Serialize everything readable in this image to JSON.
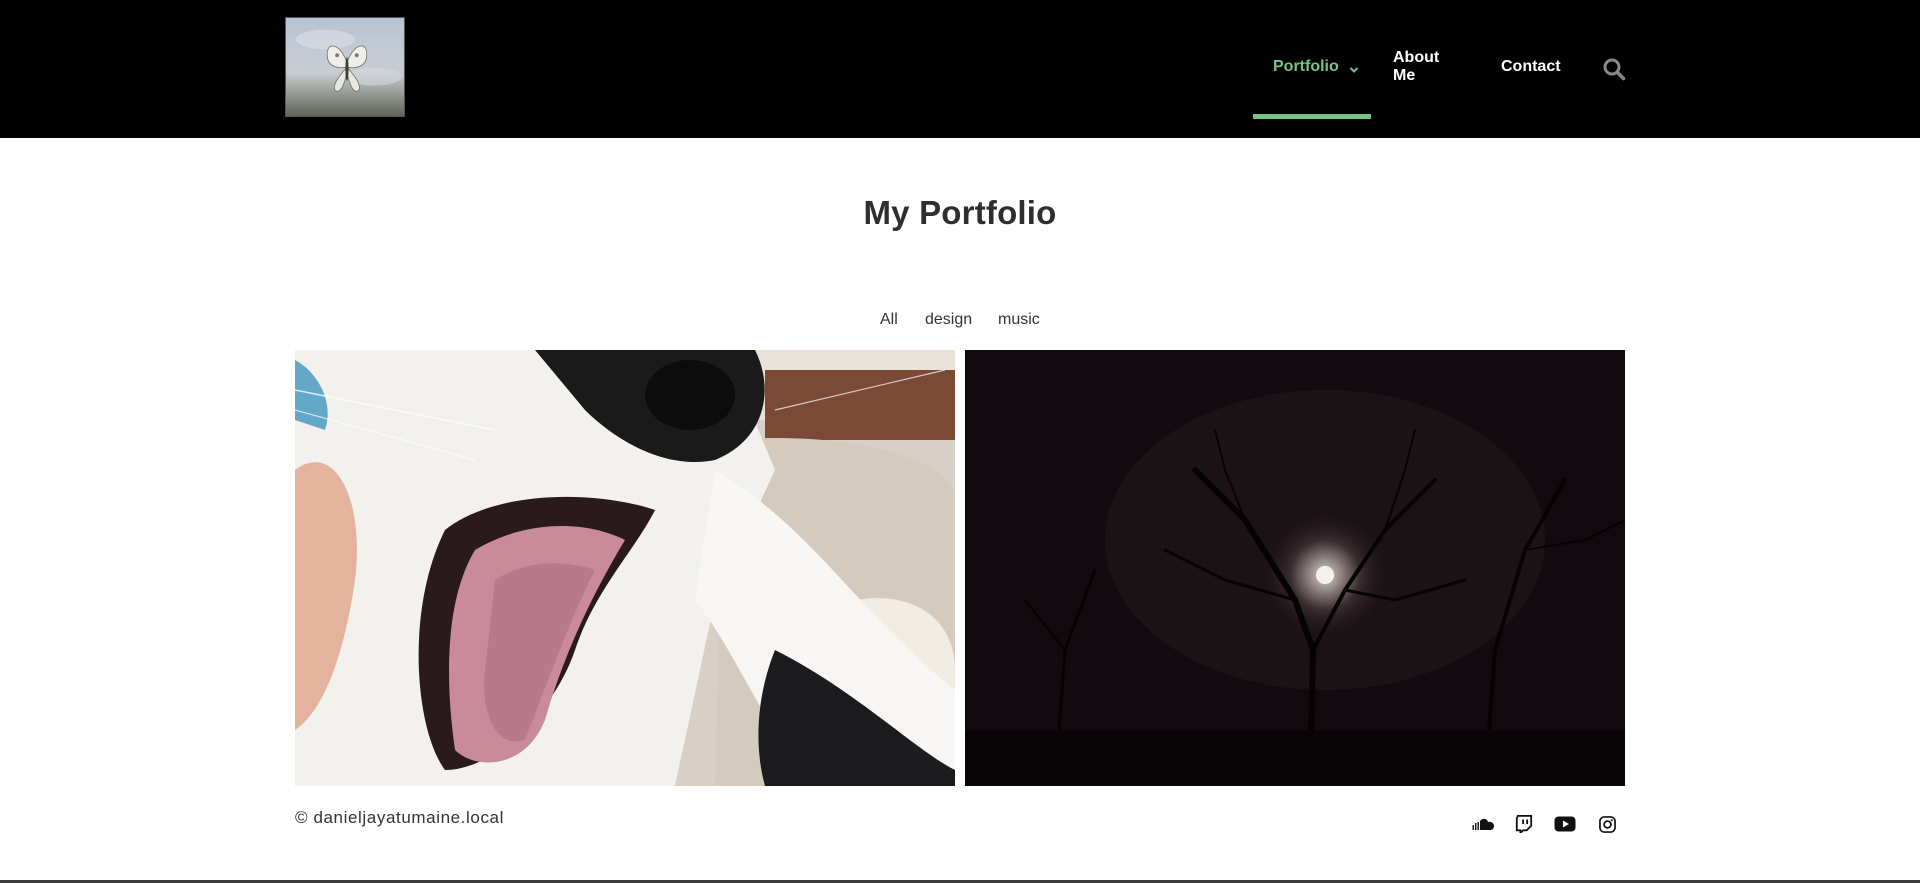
{
  "header": {
    "logo_alt": "butterfly logo",
    "nav": [
      {
        "label": "Portfolio",
        "active": true,
        "has_dropdown": true
      },
      {
        "label": "About Me",
        "active": false
      },
      {
        "label": "Contact",
        "active": false
      }
    ],
    "search_icon": "search-icon",
    "accent_color": "#77c584"
  },
  "main": {
    "title": "My Portfolio",
    "filters": [
      "All",
      "design",
      "music"
    ],
    "items": [
      {
        "image": "dog-yawning-photo"
      },
      {
        "image": "moon-through-trees-photo"
      }
    ]
  },
  "footer": {
    "copyright": "©  danieljayatumaine.local",
    "social_icons": [
      "soundcloud-icon",
      "twitch-icon",
      "youtube-icon",
      "instagram-icon"
    ]
  }
}
